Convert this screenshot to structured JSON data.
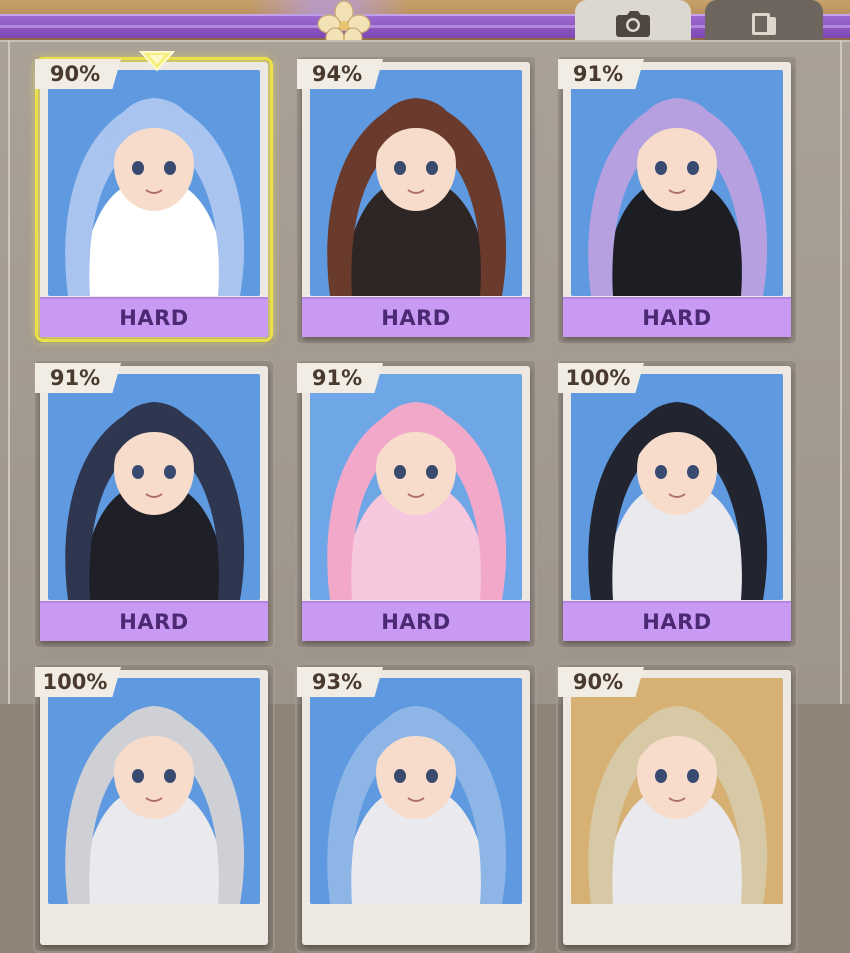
{
  "header": {
    "tabs": [
      {
        "name": "photo",
        "icon": "camera-icon",
        "active": true
      },
      {
        "name": "gallery",
        "icon": "gallery-icon",
        "active": false
      }
    ]
  },
  "cards": [
    {
      "percent": "90%",
      "difficulty": "HARD",
      "selected": true,
      "hair": "#a9c4ee",
      "sky": "#5f9ae0",
      "outfit": "#ffffff"
    },
    {
      "percent": "94%",
      "difficulty": "HARD",
      "selected": false,
      "hair": "#6a3b2d",
      "sky": "#5f9ae0",
      "outfit": "#2d2624"
    },
    {
      "percent": "91%",
      "difficulty": "HARD",
      "selected": false,
      "hair": "#b6a0e0",
      "sky": "#5f9ae0",
      "outfit": "#1d1d24"
    },
    {
      "percent": "91%",
      "difficulty": "HARD",
      "selected": false,
      "hair": "#2e3650",
      "sky": "#5f9ae0",
      "outfit": "#1f1f27"
    },
    {
      "percent": "91%",
      "difficulty": "HARD",
      "selected": false,
      "hair": "#f2a9c9",
      "sky": "#6fa6e6",
      "outfit": "#f6c8de"
    },
    {
      "percent": "100%",
      "difficulty": "HARD",
      "selected": false,
      "hair": "#222430",
      "sky": "#5f9ae0",
      "outfit": "#e9e9ee"
    },
    {
      "percent": "100%",
      "difficulty": "",
      "selected": false,
      "hair": "#cfcfd6",
      "sky": "#5f9ae0",
      "outfit": "#e9e9ee"
    },
    {
      "percent": "93%",
      "difficulty": "",
      "selected": false,
      "hair": "#8db6e6",
      "sky": "#5f9ae0",
      "outfit": "#e9e9ee"
    },
    {
      "percent": "90%",
      "difficulty": "",
      "selected": false,
      "hair": "#d7c9a6",
      "sky": "#d6b173",
      "outfit": "#e9e9ee"
    }
  ]
}
